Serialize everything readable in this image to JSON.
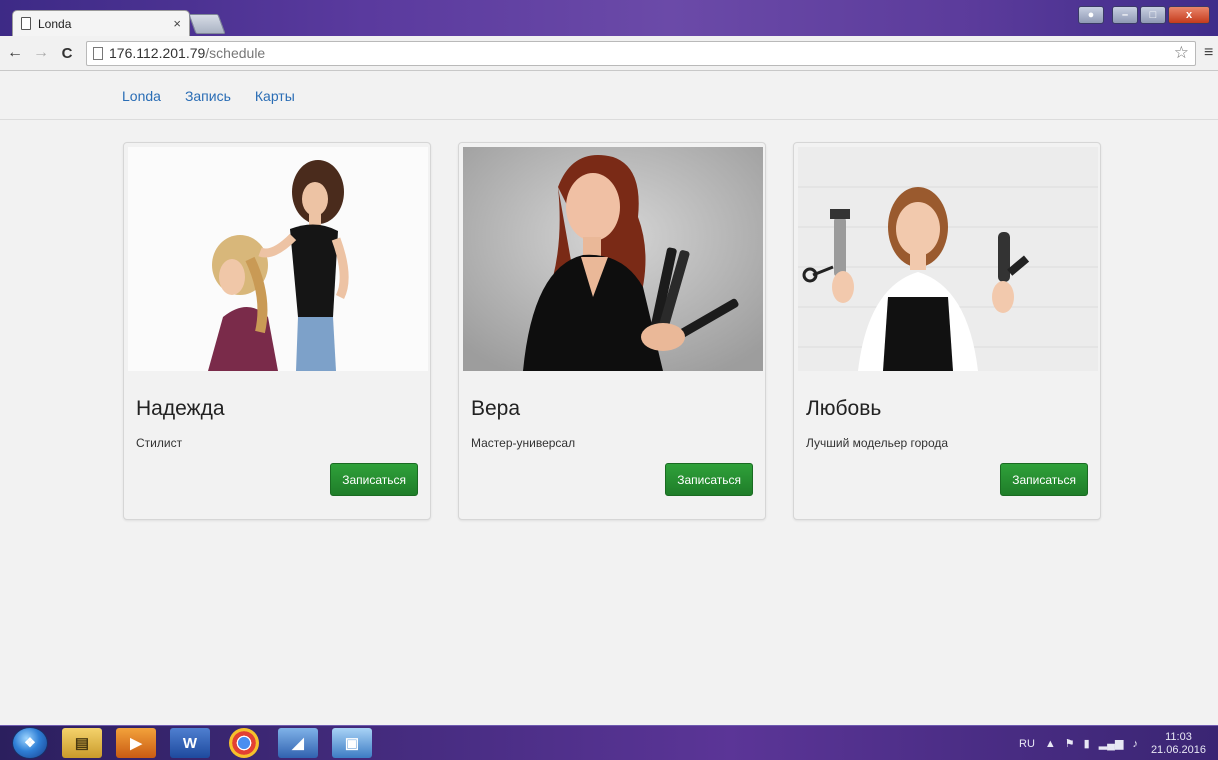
{
  "browser": {
    "tab_title": "Londa",
    "tab_close": "×",
    "url_host": "176.112.201.79",
    "url_path": "/schedule",
    "window_controls": {
      "minimize": "–",
      "maximize": "□",
      "close": "x"
    }
  },
  "site_nav": {
    "brand": "Londa",
    "items": [
      "Запись",
      "Карты"
    ]
  },
  "cards": [
    {
      "name": "Надежда",
      "role": "Стилист",
      "button": "Записаться"
    },
    {
      "name": "Вера",
      "role": "Мастер-универсал",
      "button": "Записаться"
    },
    {
      "name": "Любовь",
      "role": "Лучший модельер города",
      "button": "Записаться"
    }
  ],
  "taskbar": {
    "lang": "RU",
    "time": "11:03",
    "date": "21.06.2016"
  }
}
